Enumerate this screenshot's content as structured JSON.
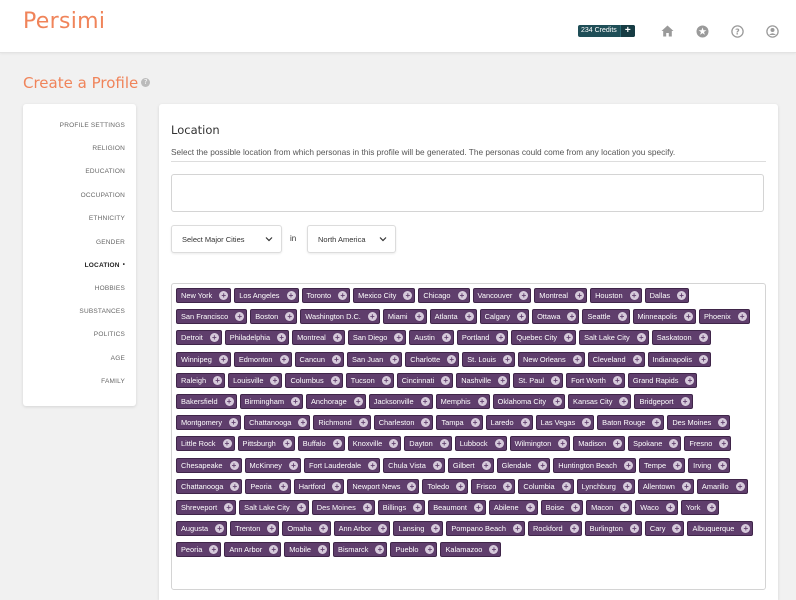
{
  "app": {
    "logo": "Persimi"
  },
  "header": {
    "credits_label": "234 Credits",
    "credits_add": "+",
    "icons": [
      "home-icon",
      "star-badge-icon",
      "help-icon",
      "user-icon"
    ]
  },
  "page": {
    "title": "Create a Profile",
    "help": "?"
  },
  "sidebar": {
    "items": [
      {
        "label": "PROFILE SETTINGS",
        "active": false
      },
      {
        "label": "RELIGION",
        "active": false
      },
      {
        "label": "EDUCATION",
        "active": false
      },
      {
        "label": "OCCUPATION",
        "active": false
      },
      {
        "label": "ETHNICITY",
        "active": false
      },
      {
        "label": "GENDER",
        "active": false
      },
      {
        "label": "LOCATION",
        "active": true
      },
      {
        "label": "HOBBIES",
        "active": false
      },
      {
        "label": "SUBSTANCES",
        "active": false
      },
      {
        "label": "POLITICS",
        "active": false
      },
      {
        "label": "AGE",
        "active": false
      },
      {
        "label": "FAMILY",
        "active": false
      }
    ]
  },
  "location": {
    "title": "Location",
    "description": "Select the possible location from which personas in this profile will be generated. The personas could come from any location you specify.",
    "input_value": "",
    "city_select": "Select Major Cities",
    "in_label": "in",
    "region_select": "North America",
    "cities": [
      "New York",
      "Los Angeles",
      "Toronto",
      "Mexico City",
      "Chicago",
      "Vancouver",
      "Montreal",
      "Houston",
      "Dallas",
      "San Francisco",
      "Boston",
      "Washington D.C.",
      "Miami",
      "Atlanta",
      "Calgary",
      "Ottawa",
      "Seattle",
      "Minneapolis",
      "Phoenix",
      "Detroit",
      "Philadelphia",
      "Montreal",
      "San Diego",
      "Austin",
      "Portland",
      "Quebec City",
      "Salt Lake City",
      "Saskatoon",
      "Winnipeg",
      "Edmonton",
      "Cancun",
      "San Juan",
      "Charlotte",
      "St. Louis",
      "New Orleans",
      "Cleveland",
      "Indianapolis",
      "Raleigh",
      "Louisville",
      "Columbus",
      "Tucson",
      "Cincinnati",
      "Nashville",
      "St. Paul",
      "Fort Worth",
      "Grand Rapids",
      "Bakersfield",
      "Birmingham",
      "Anchorage",
      "Jacksonville",
      "Memphis",
      "Oklahoma City",
      "Kansas City",
      "Bridgeport",
      "Montgomery",
      "Chattanooga",
      "Richmond",
      "Charleston",
      "Tampa",
      "Laredo",
      "Las Vegas",
      "Baton Rouge",
      "Des Moines",
      "Little Rock",
      "Pittsburgh",
      "Buffalo",
      "Knoxville",
      "Dayton",
      "Lubbock",
      "Wilmington",
      "Madison",
      "Spokane",
      "Fresno",
      "Chesapeake",
      "McKinney",
      "Fort Lauderdale",
      "Chula Vista",
      "Gilbert",
      "Glendale",
      "Huntington Beach",
      "Tempe",
      "Irving",
      "Chattanooga",
      "Peoria",
      "Hartford",
      "Newport News",
      "Toledo",
      "Frisco",
      "Columbia",
      "Lynchburg",
      "Allentown",
      "Amarillo",
      "Shreveport",
      "Salt Lake City",
      "Des Moines",
      "Billings",
      "Beaumont",
      "Abilene",
      "Boise",
      "Macon",
      "Waco",
      "York",
      "Augusta",
      "Trenton",
      "Omaha",
      "Ann Arbor",
      "Lansing",
      "Pompano Beach",
      "Rockford",
      "Burlington",
      "Cary",
      "Albuquerque",
      "Peoria",
      "Ann Arbor",
      "Mobile",
      "Bismarck",
      "Pueblo",
      "Kalamazoo"
    ]
  },
  "colors": {
    "brand": "#f0845a",
    "tag_bg": "#5f3e6c",
    "credits_bg": "#1f4e57"
  }
}
